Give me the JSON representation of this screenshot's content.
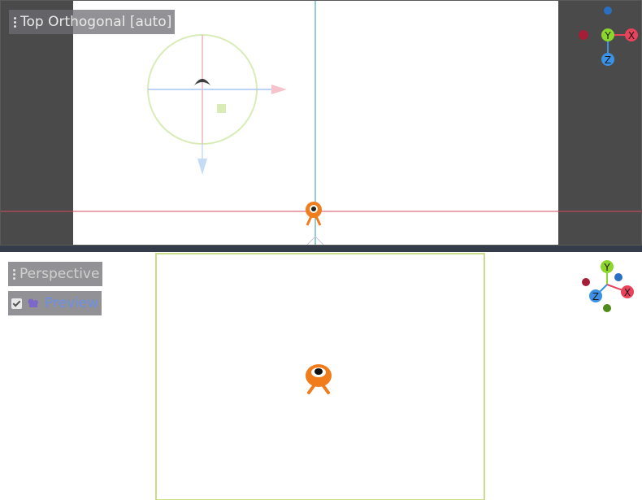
{
  "top_viewport": {
    "view_menu_label": "Top Orthogonal [auto]",
    "gizmo": {
      "y_label": "Y",
      "x_label": "X",
      "z_label": "Z"
    }
  },
  "bottom_viewport": {
    "view_menu_label": "Perspective",
    "preview_label": "Preview",
    "preview_checked": true,
    "gizmo": {
      "y_label": "Y",
      "x_label": "X",
      "z_label": "Z"
    }
  },
  "colors": {
    "x_axis": "#e8435a",
    "y_axis": "#8cd62b",
    "z_axis": "#3b91e6",
    "background_dark": "#4a4a4a",
    "canvas": "#ffffff",
    "camera_frame": "#c9dd8a",
    "character": "#f07c1c"
  },
  "icons": [
    "menu-dots-icon",
    "checkbox-icon",
    "camera-icon",
    "light-gizmo-icon",
    "character-sprite-icon"
  ]
}
